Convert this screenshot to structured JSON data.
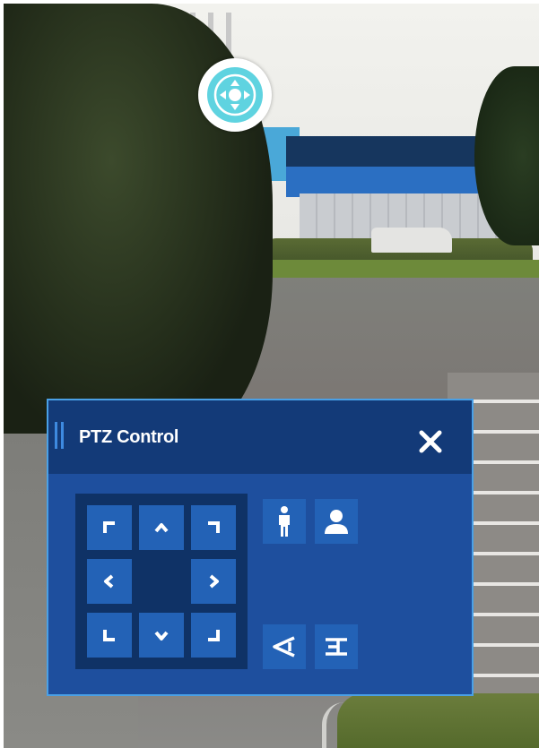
{
  "panel": {
    "title": "PTZ Control"
  },
  "icons": {
    "floating_button": "ptz-move-icon",
    "close": "close-icon",
    "dpad": [
      "arrow-up-left-icon",
      "arrow-up-icon",
      "arrow-up-right-icon",
      "arrow-left-icon",
      "arrow-right-icon",
      "arrow-down-left-icon",
      "arrow-down-icon",
      "arrow-down-right-icon"
    ],
    "side": [
      "person-full-body-icon",
      "person-upper-body-icon",
      "field-of-view-icon",
      "focal-length-icon"
    ]
  },
  "colors": {
    "panel_bg": "#1e4f9e",
    "header_bg": "#133a78",
    "button_bg": "#2362b6",
    "border": "#4aa0e6",
    "fab_accent": "#5fd3e0"
  }
}
